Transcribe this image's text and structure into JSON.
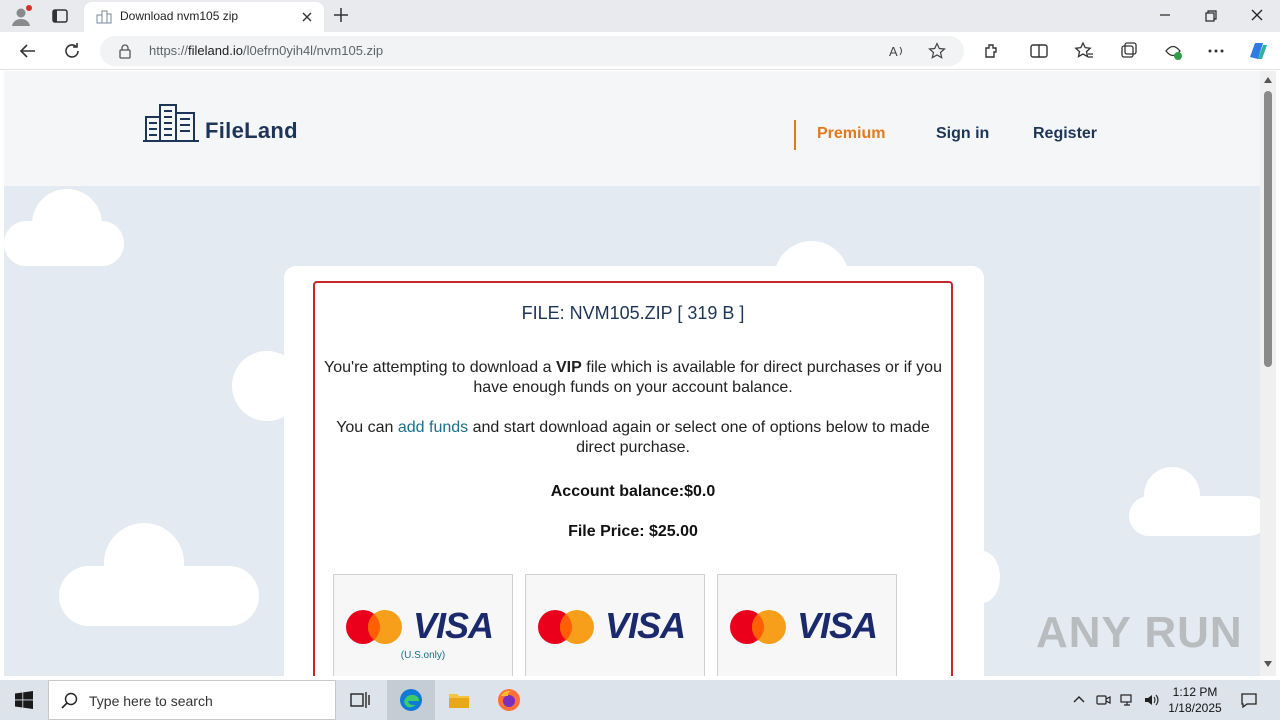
{
  "browser": {
    "tab_title": "Download nvm105 zip",
    "url_prefix": "https://",
    "url_domain": "fileland.io",
    "url_path": "/l0efrn0yih4l/nvm105.zip"
  },
  "site": {
    "logo_text": "FileLand",
    "nav": {
      "premium": "Premium",
      "signin": "Sign in",
      "register": "Register"
    },
    "accent_color": "#e07a1f",
    "brand_color": "#1d3557"
  },
  "download": {
    "file_title": "FILE: NVM105.ZIP [ 319 B ]",
    "msg1_pre": "You're attempting to download a ",
    "msg1_bold": "VIP",
    "msg1_post": " file which is available for direct purchases or if you have enough funds on your account balance.",
    "msg2_pre": "You can ",
    "msg2_link": "add funds",
    "msg2_post": " and start download again or select one of options below to made direct purchase.",
    "balance": "Account balance:$0.0",
    "price": "File Price: $25.00",
    "payment_options": [
      {
        "brand": "VISA",
        "note": "(U.S.only)"
      },
      {
        "brand": "VISA",
        "note": ""
      },
      {
        "brand": "VISA",
        "note": ""
      }
    ]
  },
  "watermark": "ANY RUN",
  "taskbar": {
    "search_placeholder": "Type here to search",
    "time": "1:12 PM",
    "date": "1/18/2025"
  }
}
